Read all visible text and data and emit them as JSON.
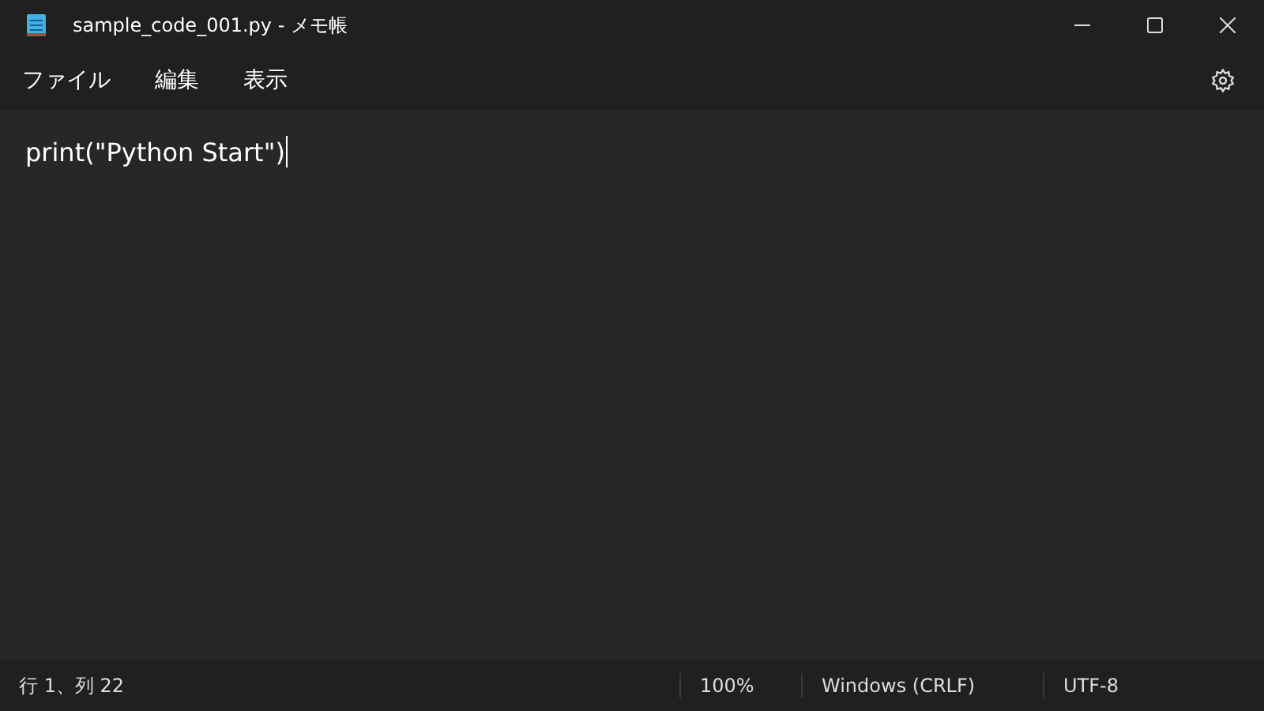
{
  "window": {
    "title": "sample_code_001.py - メモ帳"
  },
  "menu": [
    "ファイル",
    "編集",
    "表示"
  ],
  "editor": {
    "text": "print(\"Python Start\")"
  },
  "status_bar": {
    "position": "行 1、列 22",
    "zoom": "100%",
    "line_ending": "Windows (CRLF)",
    "encoding": "UTF-8"
  }
}
